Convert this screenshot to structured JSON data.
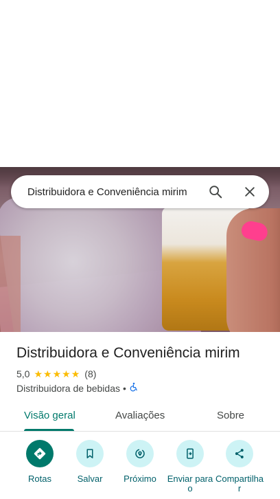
{
  "search": {
    "query": "Distribuidora e Conveniência mirim"
  },
  "place": {
    "name": "Distribuidora e Conveniência mirim",
    "rating": "5,0",
    "stars": 5,
    "review_count": "(8)",
    "category": "Distribuidora de bebidas",
    "separator": "•"
  },
  "tabs": [
    {
      "label": "Visão geral",
      "active": true
    },
    {
      "label": "Avaliações",
      "active": false
    },
    {
      "label": "Sobre",
      "active": false
    }
  ],
  "actions": [
    {
      "label": "Rotas",
      "icon": "directions-icon"
    },
    {
      "label": "Salvar",
      "icon": "bookmark-icon"
    },
    {
      "label": "Próximo",
      "icon": "nearby-icon"
    },
    {
      "label": "Enviar para o",
      "icon": "send-to-phone-icon"
    },
    {
      "label": "Compartilhar",
      "icon": "share-icon"
    }
  ],
  "colors": {
    "accent": "#00796b",
    "action_bg": "#cdf3f5",
    "star": "#fbbc04",
    "accessibility": "#1a73e8"
  }
}
